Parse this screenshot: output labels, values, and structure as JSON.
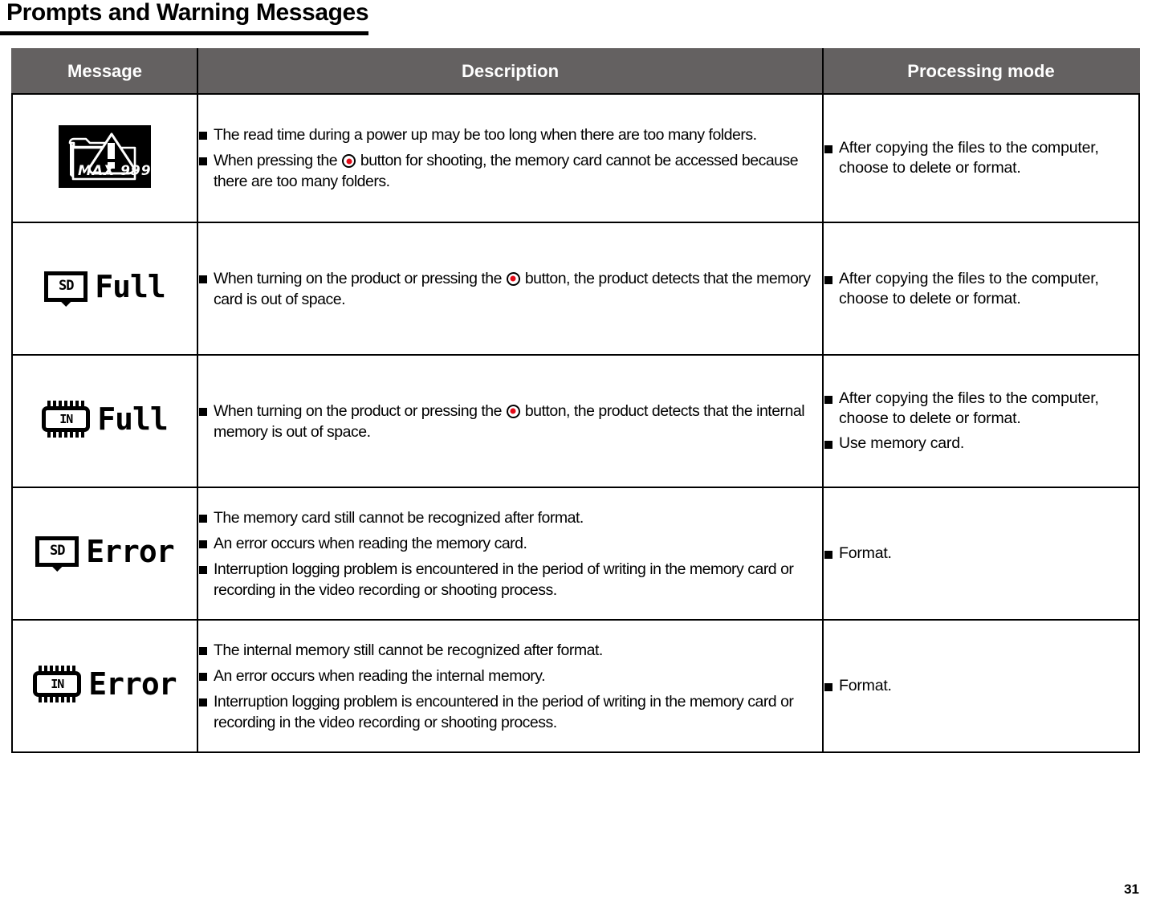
{
  "page": {
    "title": "Prompts and Warning Messages",
    "page_number": "31"
  },
  "table": {
    "headers": {
      "message": "Message",
      "description": "Description",
      "processing_mode": "Processing mode"
    },
    "rows": [
      {
        "message_icon": "folder-max-999-warning-icon",
        "message_text": "MAX 999",
        "description": [
          "The read time during a power up may be too long when there are too many folders.",
          "When pressing the ◉ button for shooting, the memory card cannot be accessed because there are too many folders."
        ],
        "description_parts": {
          "b1": "The read time during a power up may be too long when there are too many folders.",
          "b2_pre": "When pressing the ",
          "b2_post": " button for shooting, the memory card cannot be accessed because there are too many folders."
        },
        "processing_mode": [
          "After copying the files to the computer, choose to delete or format."
        ]
      },
      {
        "message_icon": "sd-card-full-icon",
        "message_badge": "SD",
        "message_text": "Full",
        "description_parts": {
          "b1_pre": "When turning on the product or pressing the ",
          "b1_post": " button, the product detects that the memory card is out of space."
        },
        "processing_mode": [
          "After copying the files to the computer, choose to delete or format."
        ]
      },
      {
        "message_icon": "internal-memory-full-icon",
        "message_badge": "IN",
        "message_text": "Full",
        "description_parts": {
          "b1_pre": "When turning on the product or pressing the ",
          "b1_post": " button, the product detects that the internal memory is out of space."
        },
        "processing_mode": [
          "After copying the files to the computer, choose to delete or format.",
          "Use memory card."
        ]
      },
      {
        "message_icon": "sd-card-error-icon",
        "message_badge": "SD",
        "message_text": "Error",
        "description": [
          "The memory card still cannot be recognized after format.",
          "An error occurs when reading the memory card.",
          "Interruption logging problem is encountered in the period of writing in the memory card or recording in the video recording or shooting process."
        ],
        "processing_mode": [
          "Format."
        ]
      },
      {
        "message_icon": "internal-memory-error-icon",
        "message_badge": "IN",
        "message_text": "Error",
        "description": [
          "The internal memory still cannot be recognized after format.",
          "An error occurs when reading the internal memory.",
          "Interruption logging problem is encountered in the period of writing in the memory card or recording in the video recording or shooting process."
        ],
        "processing_mode": [
          "Format."
        ]
      }
    ]
  },
  "colors": {
    "header_background": "#646161",
    "header_text": "#ffffff",
    "border": "#000000",
    "shutter_dot": "#e20a17",
    "lcd_background": "#000000",
    "lcd_foreground": "#ffffff"
  }
}
